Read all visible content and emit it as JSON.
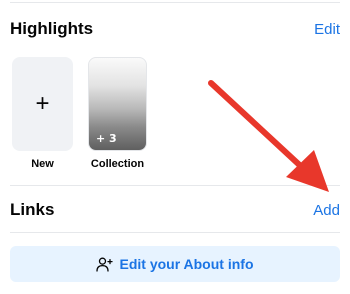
{
  "highlights": {
    "title": "Highlights",
    "edit_label": "Edit",
    "items": [
      {
        "label": "New",
        "icon": "plus-icon"
      },
      {
        "label": "Collection",
        "badge": "+ 3"
      }
    ]
  },
  "links": {
    "title": "Links",
    "add_label": "Add"
  },
  "about_button": {
    "label": "Edit your About info",
    "icon": "person-icon"
  },
  "colors": {
    "accent": "#1b74e4",
    "button_bg": "#e7f3ff",
    "annotation_arrow": "#e8372b"
  }
}
